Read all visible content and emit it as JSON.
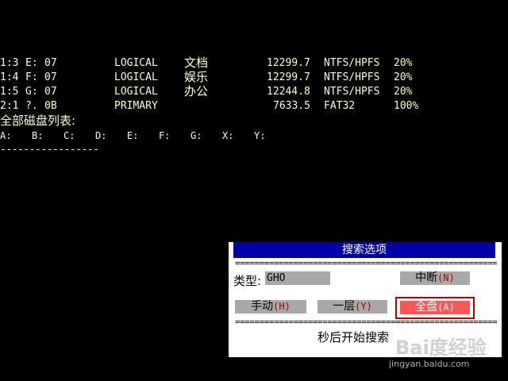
{
  "partitions": [
    {
      "id": "1:3",
      "drive": "E:",
      "type_code": "07",
      "kind": "LOGICAL",
      "label": "文档",
      "size": "12299.7",
      "fs": "NTFS/HPFS",
      "pct": "20%"
    },
    {
      "id": "1:4",
      "drive": "F:",
      "type_code": "07",
      "kind": "LOGICAL",
      "label": "娱乐",
      "size": "12299.7",
      "fs": "NTFS/HPFS",
      "pct": "20%"
    },
    {
      "id": "1:5",
      "drive": "G:",
      "type_code": "07",
      "kind": "LOGICAL",
      "label": "办公",
      "size": "12244.8",
      "fs": "NTFS/HPFS",
      "pct": "20%"
    },
    {
      "id": "2:1",
      "drive": "?.",
      "type_code": "0B",
      "kind": "PRIMARY",
      "label": "",
      "size": "7633.5",
      "fs": "FAT32",
      "pct": "100%"
    }
  ],
  "disk_list_title": "全部磁盘列表:",
  "disk_letters": [
    "A:",
    "B:",
    "C:",
    "D:",
    "E:",
    "F:",
    "G:",
    "X:",
    "Y:"
  ],
  "separator": "-----------------",
  "dialog": {
    "title": "搜索选项",
    "rule": "=================================================================",
    "type_label": "类型:",
    "type_value": "GHO",
    "buttons": {
      "interrupt": {
        "label": "中断",
        "hotkey": "N"
      },
      "manual": {
        "label": "手动",
        "hotkey": "H"
      },
      "one_level": {
        "label": "一层",
        "hotkey": "Y"
      },
      "full_disk": {
        "label": "全盘",
        "hotkey": "A"
      }
    },
    "countdown_text": "秒后开始搜索"
  },
  "watermark": {
    "logo": "Bai度经验",
    "url": "jingyan.baidu.com"
  },
  "colors": {
    "background": "#000000",
    "terminal_text": "#ffffc8",
    "dialog_bg": "#ffffff",
    "title_bar": "#0000a8",
    "button_bg": "#a8a8a8",
    "hotkey": "#a80000",
    "selected_button": "#ff5555",
    "selected_frame": "#c00000"
  }
}
